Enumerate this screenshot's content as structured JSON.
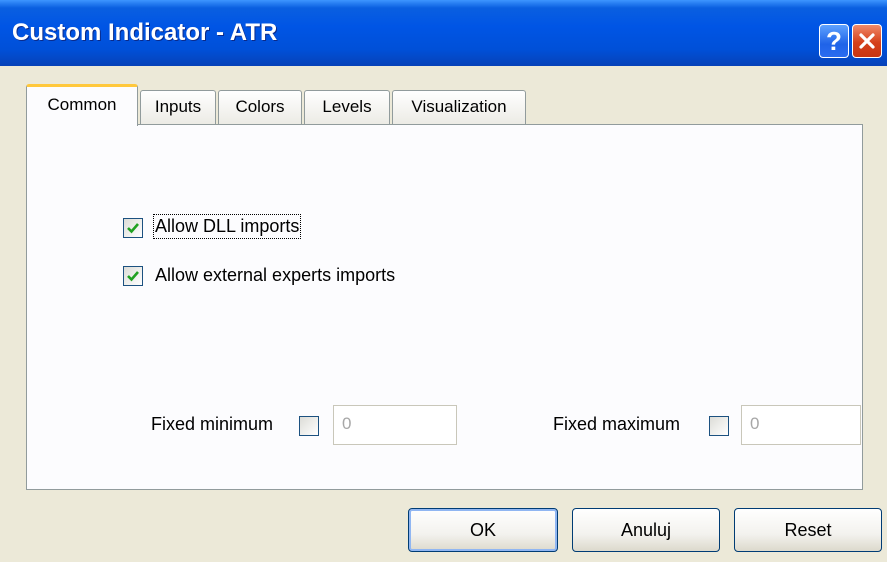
{
  "window": {
    "title": "Custom Indicator - ATR",
    "help_label": "?",
    "close_icon": "close-icon"
  },
  "tabs": [
    {
      "label": "Common",
      "active": true
    },
    {
      "label": "Inputs",
      "active": false
    },
    {
      "label": "Colors",
      "active": false
    },
    {
      "label": "Levels",
      "active": false
    },
    {
      "label": "Visualization",
      "active": false
    }
  ],
  "common": {
    "allow_dll": {
      "label": "Allow DLL imports",
      "checked": true
    },
    "allow_external": {
      "label": "Allow external experts imports",
      "checked": true
    },
    "fixed_minimum": {
      "label": "Fixed minimum",
      "checked": false,
      "value": "0"
    },
    "fixed_maximum": {
      "label": "Fixed maximum",
      "checked": false,
      "value": "0"
    }
  },
  "buttons": {
    "ok": "OK",
    "cancel": "Anuluj",
    "reset": "Reset"
  },
  "colors": {
    "titlebar": "#0055e5",
    "check": "#21a121",
    "active_tab_accent": "#ffc83c"
  }
}
